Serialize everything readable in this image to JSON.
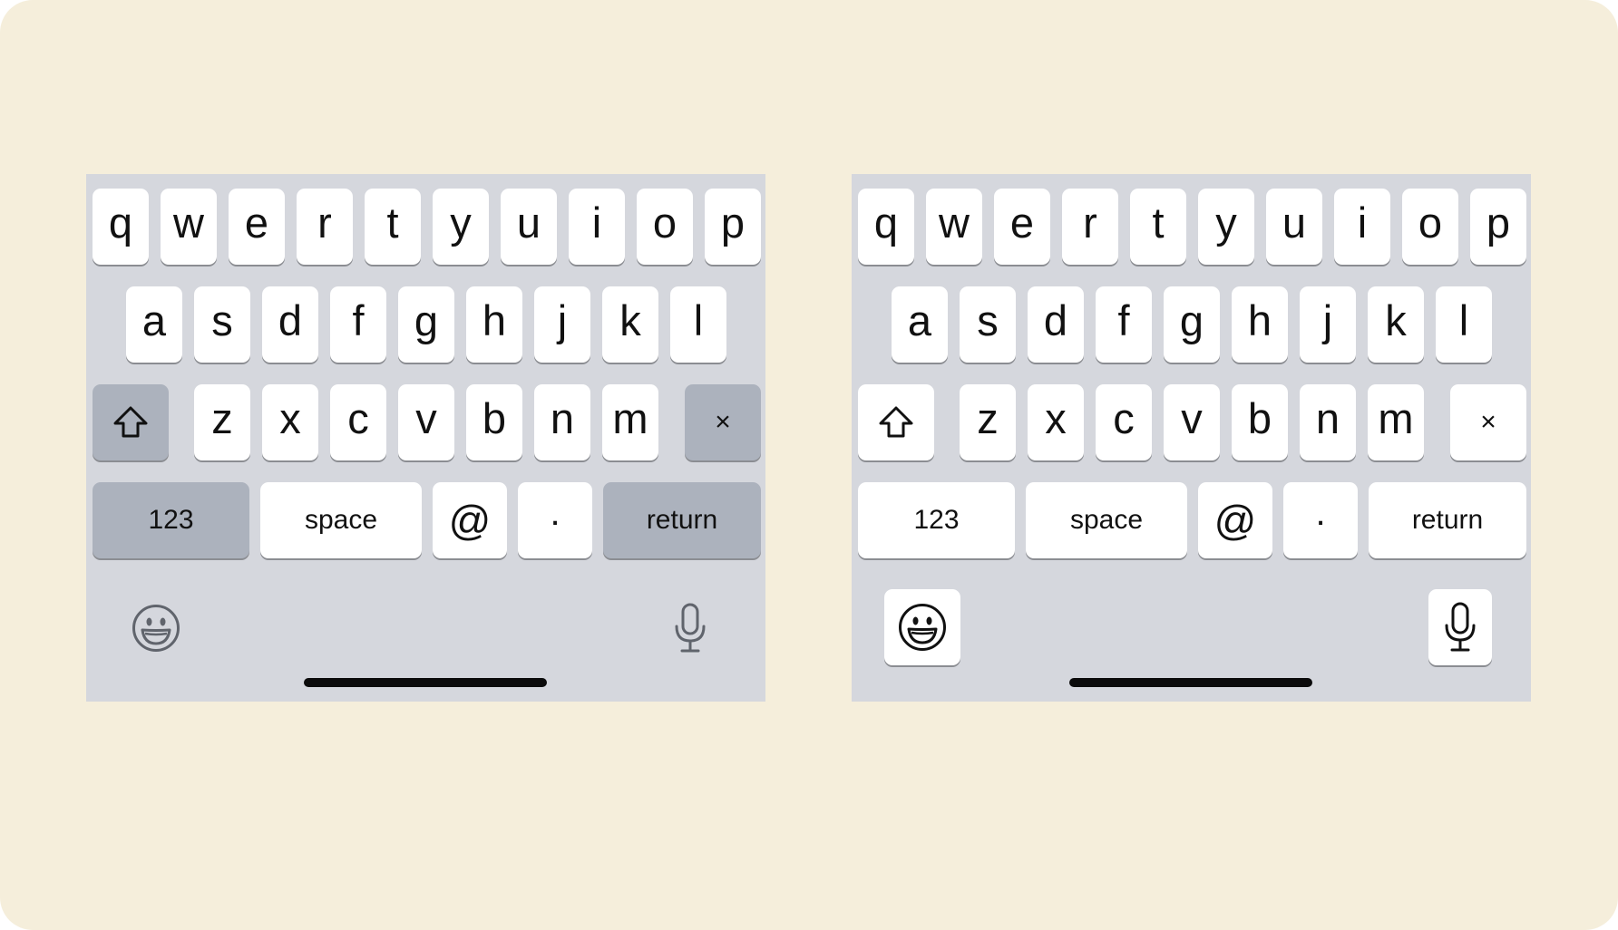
{
  "keyboards": [
    {
      "variant": "modifier keys shaded",
      "row1": [
        "q",
        "w",
        "e",
        "r",
        "t",
        "y",
        "u",
        "i",
        "o",
        "p"
      ],
      "row2": [
        "a",
        "s",
        "d",
        "f",
        "g",
        "h",
        "j",
        "k",
        "l"
      ],
      "row3": [
        "z",
        "x",
        "c",
        "v",
        "b",
        "n",
        "m"
      ],
      "shift_icon": "shift-arrow-icon",
      "delete_label": "×",
      "numbers_label": "123",
      "space_label": "space",
      "at_label": "@",
      "period_label": ".",
      "return_label": "return",
      "emoji_icon": "emoji-face-icon",
      "mic_icon": "microphone-icon"
    },
    {
      "variant": "all keys white",
      "row1": [
        "q",
        "w",
        "e",
        "r",
        "t",
        "y",
        "u",
        "i",
        "o",
        "p"
      ],
      "row2": [
        "a",
        "s",
        "d",
        "f",
        "g",
        "h",
        "j",
        "k",
        "l"
      ],
      "row3": [
        "z",
        "x",
        "c",
        "v",
        "b",
        "n",
        "m"
      ],
      "shift_icon": "shift-arrow-icon",
      "delete_label": "×",
      "numbers_label": "123",
      "space_label": "space",
      "at_label": "@",
      "period_label": ".",
      "return_label": "return",
      "emoji_icon": "emoji-face-icon",
      "mic_icon": "microphone-icon"
    }
  ],
  "colors": {
    "page_background": "#f5eedb",
    "keyboard_background": "#d5d7dd",
    "key_white": "#ffffff",
    "key_modifier": "#acb2bd",
    "key_shadow": "#8b8d92",
    "home_indicator": "#0b0b0b"
  }
}
